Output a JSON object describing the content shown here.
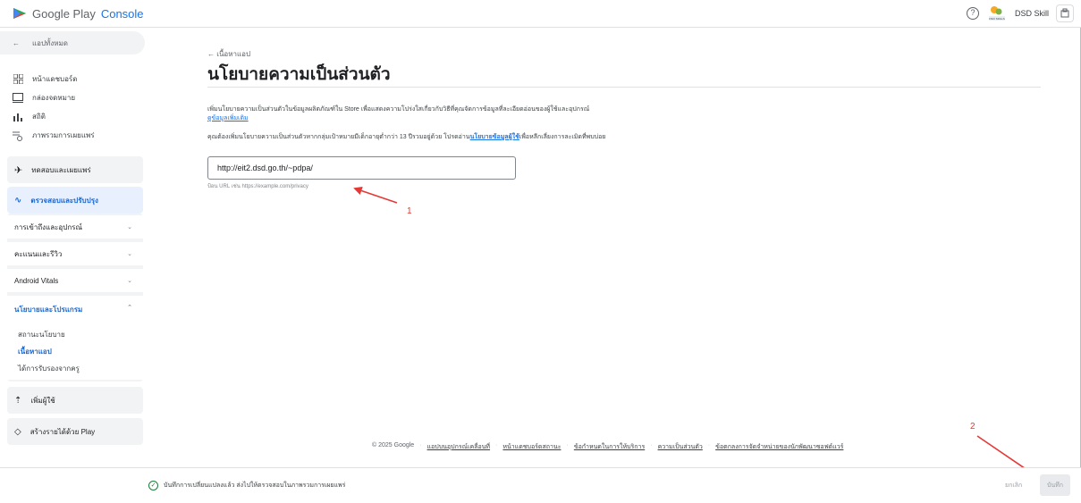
{
  "header": {
    "logo_google": "Google Play",
    "logo_console": "Console",
    "account_name": "DSD Skill",
    "dev_logo_text": "DSD SKILLS"
  },
  "sidebar": {
    "back_label": "แอปทั้งหมด",
    "items": [
      {
        "label": "หน้าแดชบอร์ด",
        "icon": "dashboard-icon"
      },
      {
        "label": "กล่องจดหมาย",
        "icon": "inbox-icon"
      },
      {
        "label": "สถิติ",
        "icon": "stats-icon"
      },
      {
        "label": "ภาพรวมการเผยแพร่",
        "icon": "publishing-icon"
      }
    ],
    "test_release": "ทดสอบและเผยแพร่",
    "monitor_improve": "ตรวจสอบและปรับปรุง",
    "sub_sections": [
      "การเข้าถึงและอุปกรณ์",
      "คะแนนและรีวิว",
      "Android Vitals",
      "นโยบายและโปรแกรม"
    ],
    "policy_leaves": [
      "สถานะนโยบาย",
      "เนื้อหาแอป",
      "ได้การรับรองจากครู"
    ],
    "grow_users": "เพิ่มผู้ใช้",
    "monetize": "สร้างรายได้ด้วย Play"
  },
  "main": {
    "breadcrumb": "← เนื้อหาแอป",
    "title": "นโยบายความเป็นส่วนตัว",
    "description_1": "เพิ่มนโยบายความเป็นส่วนตัวในข้อมูลผลิตภัณฑ์ใน Store เพื่อแสดงความโปร่งใสเกี่ยวกับวิธีที่คุณจัดการข้อมูลที่ละเอียดอ่อนของผู้ใช้และอุปกรณ์",
    "learn_more": "ดูข้อมูลเพิ่มเติม",
    "description_2_prefix": "คุณต้องเพิ่มนโยบายความเป็นส่วนตัวหากกลุ่มเป้าหมายมีเด็กอายุต่ำกว่า 13 ปีรวมอยู่ด้วย โปรดอ่าน",
    "description_2_link": "นโยบายข้อมูลผู้ใช้",
    "description_2_suffix": "เพื่อหลีกเลี่ยงการละเมิดที่พบบ่อย",
    "url_value": "http://eit2.dsd.go.th/~pdpa/",
    "url_hint": "ป้อน URL เช่น https://example.com/privacy"
  },
  "annotations": {
    "one": "1",
    "two": "2",
    "color": "#e53935"
  },
  "footer": {
    "copyright": "© 2025 Google",
    "links": [
      "แอปบนอุปกรณ์เคลื่อนที่",
      "หน้าแดชบอร์ดสถานะ",
      "ข้อกำหนดในการให้บริการ",
      "ความเป็นส่วนตัว",
      "ข้อตกลงการจัดจำหน่ายของนักพัฒนาซอฟต์แวร์"
    ]
  },
  "bottombar": {
    "status": "บันทึกการเปลี่ยนแปลงแล้ว ส่งไปให้ตรวจสอบในภาพรวมการเผยแพร่",
    "discard": "ยกเลิก",
    "save": "บันทึก"
  },
  "colors": {
    "accent": "#1a73e8",
    "active_bg": "#e8f0fe",
    "group_bg": "#f1f3f4"
  }
}
